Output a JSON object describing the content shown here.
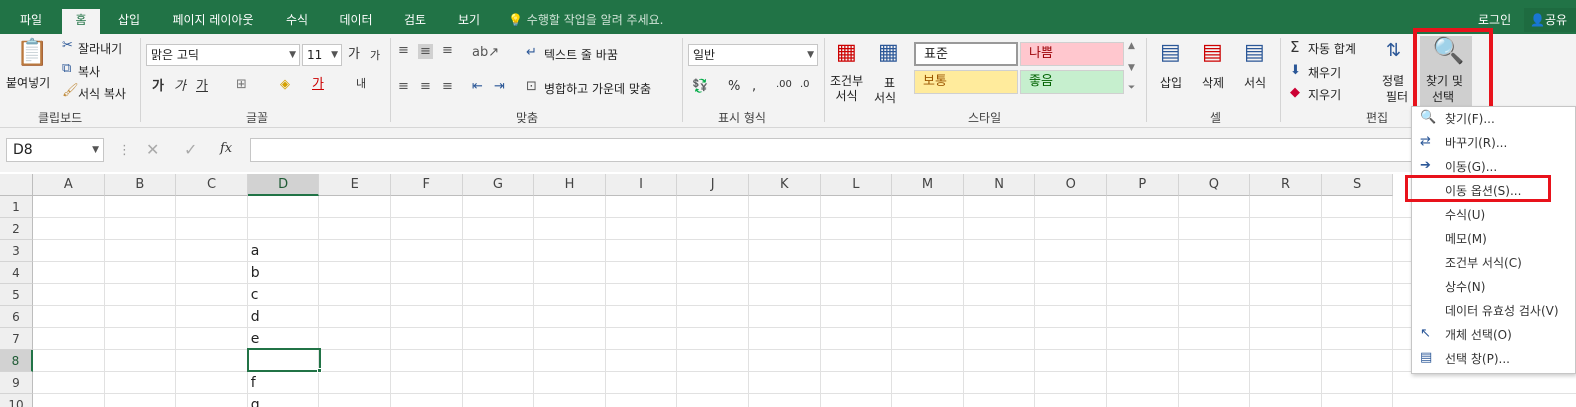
{
  "tabs": [
    "파일",
    "홈",
    "삽입",
    "페이지 레이아웃",
    "수식",
    "데이터",
    "검토",
    "보기"
  ],
  "tell_me": "수행할 작업을 알려 주세요.",
  "login": "로그인",
  "share": "공유",
  "clipboard": {
    "paste": "붙여넣기",
    "cut": "잘라내기",
    "copy": "복사",
    "format_painter": "서식 복사",
    "label": "클립보드"
  },
  "font": {
    "name": "맑은 고딕",
    "size": "11",
    "label": "글꼴"
  },
  "alignment": {
    "wrap_text": "텍스트 줄 바꿈",
    "merge_center": "병합하고 가운데 맞춤",
    "label": "맞춤"
  },
  "number": {
    "format": "일반",
    "label": "표시 형식"
  },
  "styles": {
    "conditional": "조건부\n서식",
    "format_table_1": "표",
    "format_table_2": "서식",
    "normal": "표준",
    "bad": "나쁨",
    "neutral": "보통",
    "good": "좋음",
    "label": "스타일"
  },
  "cells": {
    "insert": "삽입",
    "delete": "삭제",
    "format": "서식",
    "label": "셀"
  },
  "editing": {
    "autosum": "자동 합계",
    "fill": "채우기",
    "clear": "지우기",
    "sort_1": "정렬",
    "sort_2": "필터",
    "find_1": "찾기 및",
    "find_2": "선택",
    "label": "편집"
  },
  "name_box": "D8",
  "fx": "fx",
  "columns": [
    "A",
    "B",
    "C",
    "D",
    "E",
    "F",
    "G",
    "H",
    "I",
    "J",
    "K",
    "L",
    "M",
    "N",
    "O",
    "P",
    "Q",
    "R",
    "S"
  ],
  "rows": [
    "1",
    "2",
    "3",
    "4",
    "5",
    "6",
    "7",
    "8",
    "9",
    "10"
  ],
  "cell_values": [
    "a",
    "b",
    "c",
    "d",
    "e",
    "f",
    "g"
  ],
  "menu": [
    {
      "label": "찾기(F)...",
      "icon": "search-icon"
    },
    {
      "label": "바꾸기(R)...",
      "icon": "replace-icon"
    },
    {
      "label": "이동(G)...",
      "icon": "arrow-right-icon"
    },
    {
      "label": "이동 옵션(S)...",
      "icon": ""
    },
    {
      "label": "수식(U)",
      "icon": ""
    },
    {
      "label": "메모(M)",
      "icon": ""
    },
    {
      "label": "조건부 서식(C)",
      "icon": ""
    },
    {
      "label": "상수(N)",
      "icon": ""
    },
    {
      "label": "데이터 유효성 검사(V)",
      "icon": ""
    },
    {
      "label": "개체 선택(O)",
      "icon": "pointer-icon"
    },
    {
      "label": "선택 창(P)...",
      "icon": "selection-pane-icon"
    }
  ],
  "colors": {
    "accent": "#217346",
    "highlight": "#e8121b",
    "bad_bg": "#ffc7ce",
    "bad_fg": "#9c0006",
    "neutral_bg": "#ffeb9c",
    "neutral_fg": "#9c5700",
    "good_bg": "#c6efce",
    "good_fg": "#006100"
  }
}
